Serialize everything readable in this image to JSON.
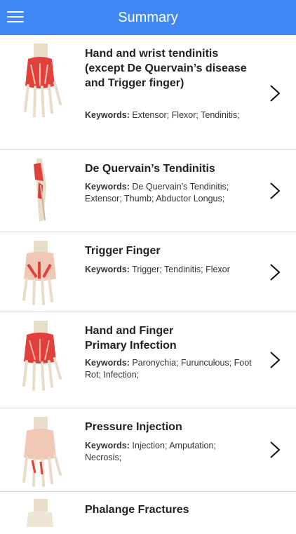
{
  "header": {
    "title": "Summary",
    "menu_icon": "hamburger-menu-icon"
  },
  "keywords_label": "Keywords:",
  "items": [
    {
      "title": "Hand and wrist tendinitis (except De Quervain’s disease and Trigger finger)",
      "keywords": "Extensor; Flexor; Tendinitis;"
    },
    {
      "title": "De Quervain’s Tendinitis",
      "keywords": "De Quervain’s Tendinitis; Extensor; Thumb; Abductor Longus;"
    },
    {
      "title": "Trigger Finger",
      "keywords": "Trigger; Tendinitis; Flexor"
    },
    {
      "title": "Hand and Finger Primary Infection",
      "keywords": "Paronychia; Furunculous; Foot Rot; Infection;"
    },
    {
      "title": "Pressure Injection",
      "keywords": "Injection; Amputation; Necrosis;"
    },
    {
      "title": "Phalange Fractures",
      "keywords": ""
    }
  ],
  "colors": {
    "accent": "#3f88f4",
    "muscle": "#e2403a",
    "bone": "#e9dcc8"
  }
}
